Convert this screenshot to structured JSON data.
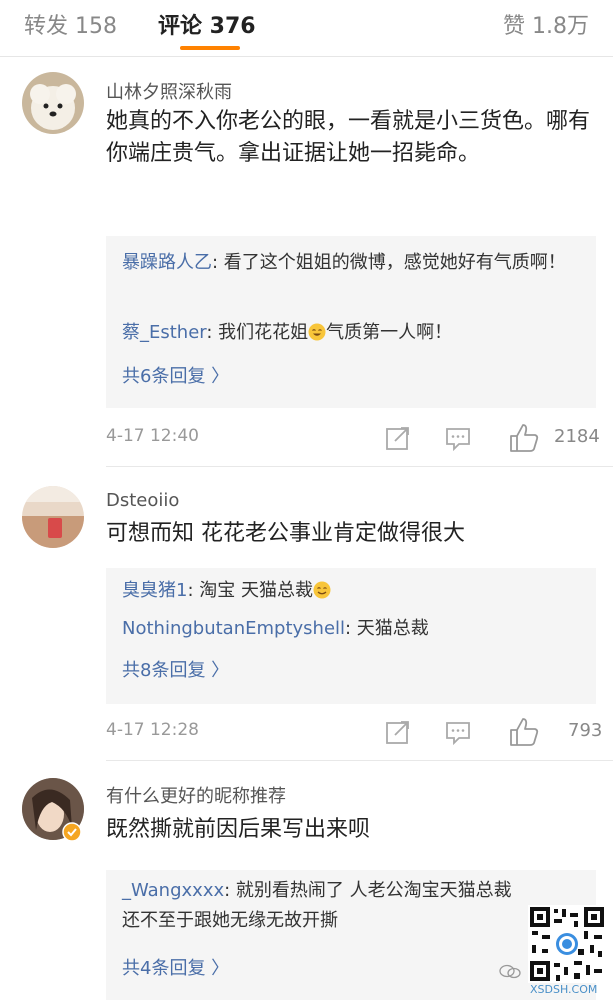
{
  "tabs": {
    "repost": "转发 158",
    "comments": "评论 376",
    "likes": "赞 1.8万"
  },
  "comments": [
    {
      "username": "山林夕照深秋雨",
      "text": "她真的不入你老公的眼，一看就是小三货色。哪有你端庄贵气。拿出证据让她一招毙命。",
      "replies": [
        {
          "name": "暴躁路人乙",
          "text": ": 看了这个姐姐的微博，感觉她好有气质啊！"
        },
        {
          "name": "蔡_Esther",
          "text_before": ": 我们花花姐",
          "text_after": "气质第一人啊！"
        }
      ],
      "more": "共6条回复 〉",
      "time": "4-17 12:40",
      "likes": "2184"
    },
    {
      "username": "Dsteoiio",
      "text": "可想而知 花花老公事业肯定做得很大",
      "replies": [
        {
          "name": "臭臭猪1",
          "text": ": 淘宝 天猫总裁"
        },
        {
          "name": "NothingbutanEmptyshell",
          "text": ": 天猫总裁"
        }
      ],
      "more": "共8条回复 〉",
      "time": "4-17 12:28",
      "likes": "793"
    },
    {
      "username": "有什么更好的昵称推荐",
      "text": "既然撕就前因后果写出来呗",
      "replies": [
        {
          "name": "_Wangxxxx",
          "text": ": 就别看热闹了 人老公淘宝天猫总裁 还不至于跟她无缘无故开撕"
        }
      ],
      "more": "共4条回复 〉"
    }
  ],
  "watermark": {
    "site": "XSDSH.COM"
  },
  "colors": {
    "accent": "#ff8200",
    "link": "#4a6ea8"
  }
}
